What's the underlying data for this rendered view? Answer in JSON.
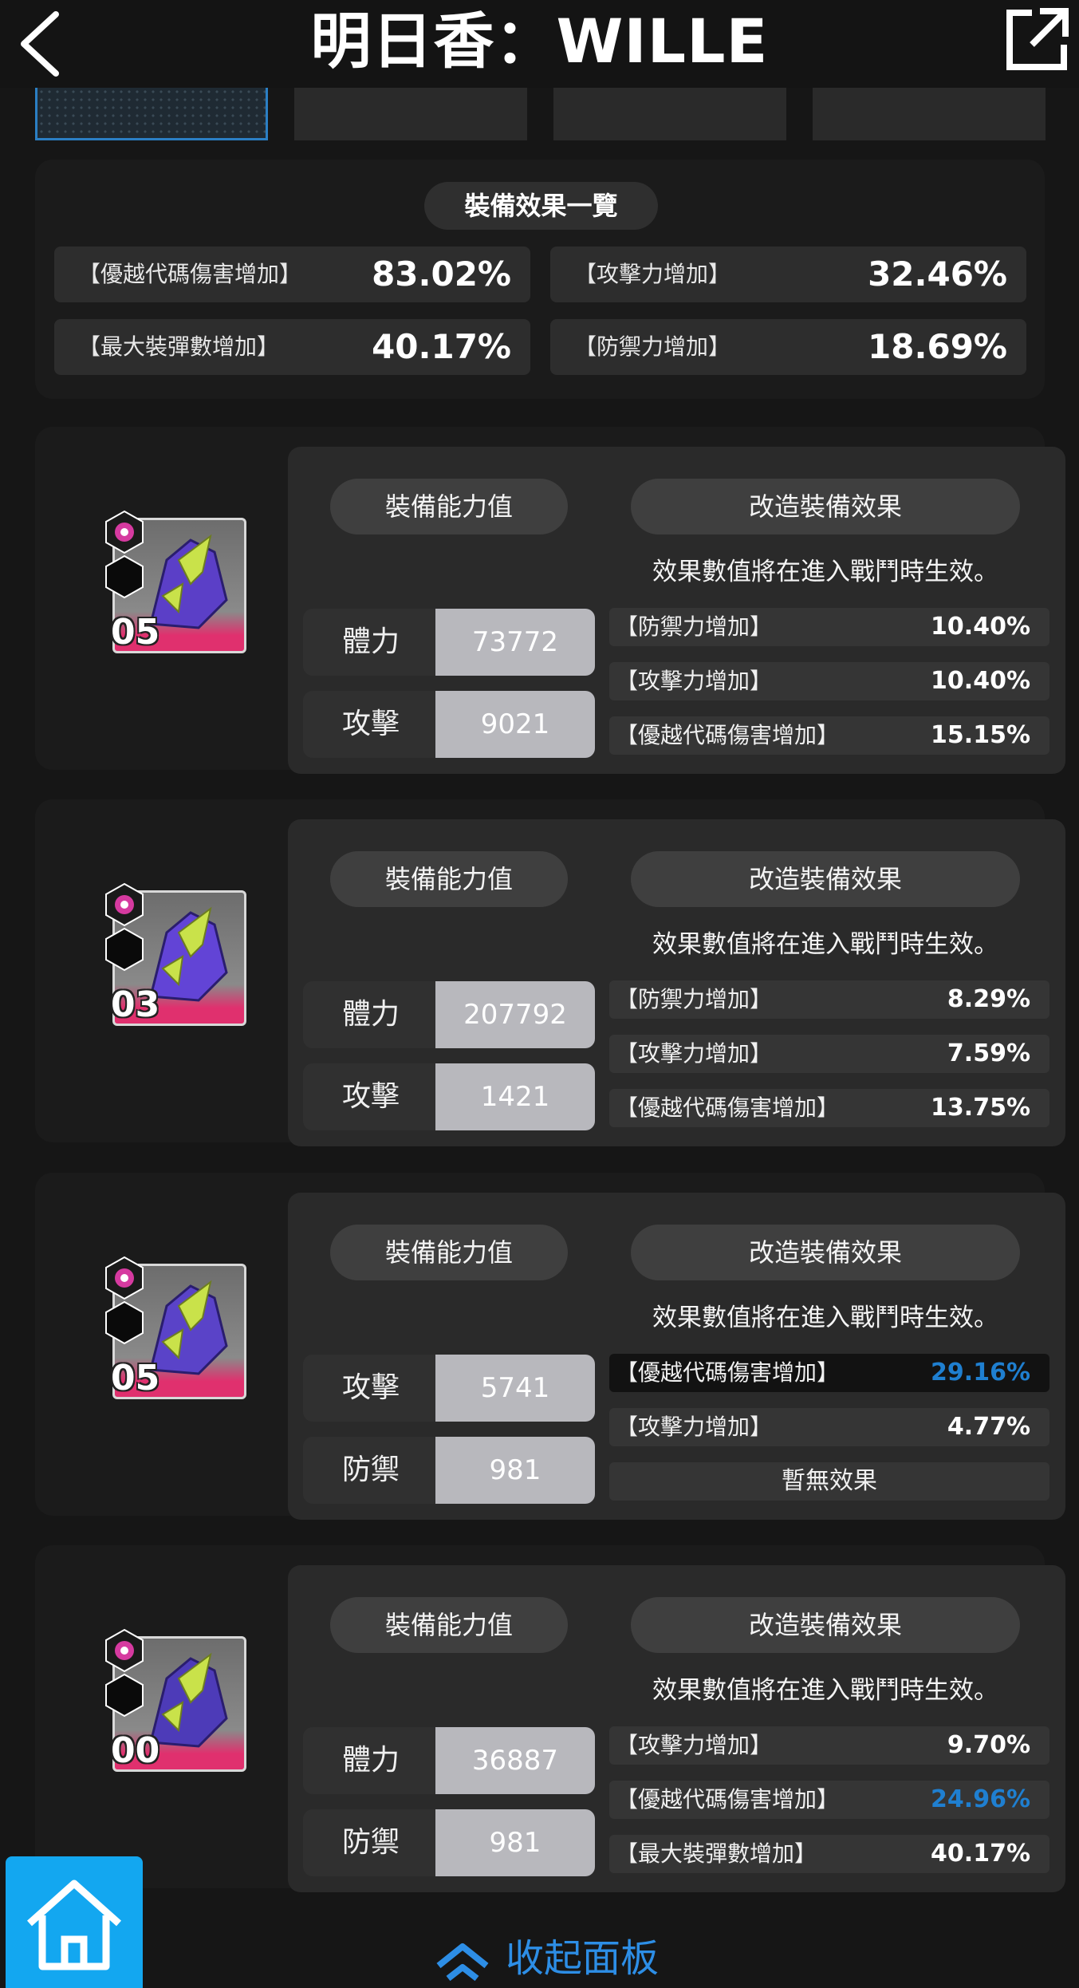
{
  "header": {
    "title": "明日香：WILLE",
    "back_icon": "chevron-left-icon",
    "share_icon": "external-link-icon"
  },
  "summary": {
    "title": "裝備效果一覽",
    "items": [
      {
        "label": "【優越代碼傷害增加】",
        "value": "83.02%"
      },
      {
        "label": "【攻擊力增加】",
        "value": "32.46%"
      },
      {
        "label": "【最大裝彈數增加】",
        "value": "40.17%"
      },
      {
        "label": "【防禦力增加】",
        "value": "18.69%"
      }
    ]
  },
  "equipment": [
    {
      "level": "05",
      "stat_tab": "裝備能力值",
      "mod_tab": "改造裝備效果",
      "note": "效果數值將在進入戰鬥時生效。",
      "stats": [
        {
          "label": "體力",
          "value": "73772"
        },
        {
          "label": "攻擊",
          "value": "9021"
        }
      ],
      "effects": [
        {
          "label": "【防禦力增加】",
          "value": "10.40%",
          "highlight": false,
          "color": "#ffffff"
        },
        {
          "label": "【攻擊力增加】",
          "value": "10.40%",
          "highlight": false,
          "color": "#ffffff"
        },
        {
          "label": "【優越代碼傷害增加】",
          "value": "15.15%",
          "highlight": false,
          "color": "#ffffff"
        }
      ]
    },
    {
      "level": "03",
      "stat_tab": "裝備能力值",
      "mod_tab": "改造裝備效果",
      "note": "效果數值將在進入戰鬥時生效。",
      "stats": [
        {
          "label": "體力",
          "value": "207792"
        },
        {
          "label": "攻擊",
          "value": "1421"
        }
      ],
      "effects": [
        {
          "label": "【防禦力增加】",
          "value": "8.29%",
          "highlight": false,
          "color": "#ffffff"
        },
        {
          "label": "【攻擊力增加】",
          "value": "7.59%",
          "highlight": false,
          "color": "#ffffff"
        },
        {
          "label": "【優越代碼傷害增加】",
          "value": "13.75%",
          "highlight": false,
          "color": "#ffffff"
        }
      ]
    },
    {
      "level": "05",
      "stat_tab": "裝備能力值",
      "mod_tab": "改造裝備效果",
      "note": "效果數值將在進入戰鬥時生效。",
      "stats": [
        {
          "label": "攻擊",
          "value": "5741"
        },
        {
          "label": "防禦",
          "value": "981"
        }
      ],
      "effects": [
        {
          "label": "【優越代碼傷害增加】",
          "value": "29.16%",
          "highlight": true,
          "color": "#1f7fd0"
        },
        {
          "label": "【攻擊力增加】",
          "value": "4.77%",
          "highlight": false,
          "color": "#ffffff"
        },
        {
          "label": "",
          "value": "",
          "empty_text": "暫無效果",
          "highlight": false,
          "color": "#ffffff"
        }
      ]
    },
    {
      "level": "00",
      "stat_tab": "裝備能力值",
      "mod_tab": "改造裝備效果",
      "note": "效果數值將在進入戰鬥時生效。",
      "stats": [
        {
          "label": "體力",
          "value": "36887"
        },
        {
          "label": "防禦",
          "value": "981"
        }
      ],
      "effects": [
        {
          "label": "【攻擊力增加】",
          "value": "9.70%",
          "highlight": false,
          "color": "#ffffff"
        },
        {
          "label": "【優越代碼傷害增加】",
          "value": "24.96%",
          "highlight": false,
          "color": "#1f7fd0"
        },
        {
          "label": "【最大裝彈數增加】",
          "value": "40.17%",
          "highlight": false,
          "color": "#ffffff"
        }
      ]
    }
  ],
  "footer": {
    "home_icon": "home-icon",
    "collapse_label": "收起面板",
    "collapse_icon": "chevron-up-double-icon"
  },
  "colors": {
    "accent_blue": "#1f7fd0",
    "home_button": "#13a7f0",
    "rarity_pink": "#e0306e"
  }
}
